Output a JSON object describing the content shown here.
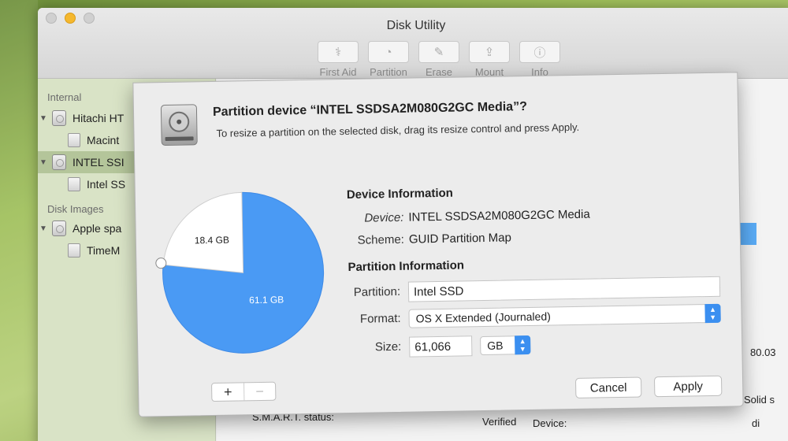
{
  "window": {
    "title": "Disk Utility"
  },
  "toolbar": [
    {
      "label": "First Aid",
      "icon": "stethoscope-icon"
    },
    {
      "label": "Partition",
      "icon": "partition-icon"
    },
    {
      "label": "Erase",
      "icon": "erase-icon"
    },
    {
      "label": "Mount",
      "icon": "mount-icon"
    },
    {
      "label": "Info",
      "icon": "info-icon"
    }
  ],
  "sidebar": {
    "internal_header": "Internal",
    "disk_images_header": "Disk Images",
    "items": [
      {
        "label": "Hitachi HT"
      },
      {
        "label": "Macint"
      },
      {
        "label": "INTEL SSI"
      },
      {
        "label": "Intel SS"
      },
      {
        "label": "Apple spa"
      },
      {
        "label": "TimeM"
      }
    ]
  },
  "background_panel": {
    "value_right": "80.03",
    "smart_label": "S.M.A.R.T. status:",
    "smart_value": "Verified",
    "device_label": "Device:",
    "type_value": "Solid s",
    "device_value": "di"
  },
  "sheet": {
    "title": "Partition device “INTEL SSDSA2M080G2GC Media”?",
    "subtitle": "To resize a partition on the selected disk, drag its resize control and press Apply.",
    "pie": {
      "free_label": "18.4 GB",
      "used_label": "61.1 GB",
      "free_gb": 18.4,
      "used_gb": 61.1,
      "used_color": "#4a9af4",
      "free_color": "#ffffff"
    },
    "add_button": "+",
    "remove_button": "−",
    "device_info": {
      "heading": "Device Information",
      "device_label": "Device:",
      "device_value": "INTEL SSDSA2M080G2GC Media",
      "scheme_label": "Scheme:",
      "scheme_value": "GUID Partition Map"
    },
    "partition_info": {
      "heading": "Partition Information",
      "partition_label": "Partition:",
      "partition_value": "Intel SSD",
      "format_label": "Format:",
      "format_value": "OS X Extended (Journaled)",
      "size_label": "Size:",
      "size_value": "61,066",
      "unit_value": "GB"
    },
    "cancel_button": "Cancel",
    "apply_button": "Apply"
  }
}
